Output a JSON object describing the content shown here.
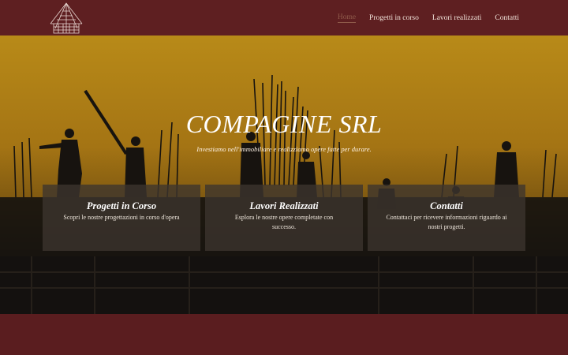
{
  "header": {
    "nav": [
      {
        "label": "Home",
        "active": true
      },
      {
        "label": "Progetti in corso",
        "active": false
      },
      {
        "label": "Lavori realizzati",
        "active": false
      },
      {
        "label": "Contatti",
        "active": false
      }
    ]
  },
  "hero": {
    "title": "COMPAGINE SRL",
    "subtitle": "Investiamo nell'immobiliare e realizziamo opere fatte per durare."
  },
  "cards": [
    {
      "title": "Progetti in Corso",
      "text": "Scopri le nostre progettazioni in corso d'opera"
    },
    {
      "title": "Lavori Realizzati",
      "text": "Esplora le nostre opere completate con successo."
    },
    {
      "title": "Contatti",
      "text": "Contattaci per ricevere informazioni riguardo ai nostri progetti."
    }
  ],
  "colors": {
    "brand": "#5e1f21",
    "sky": "#b88a18",
    "card_bg": "#3c342e"
  },
  "icons": {
    "logo": "building-logo-icon"
  }
}
